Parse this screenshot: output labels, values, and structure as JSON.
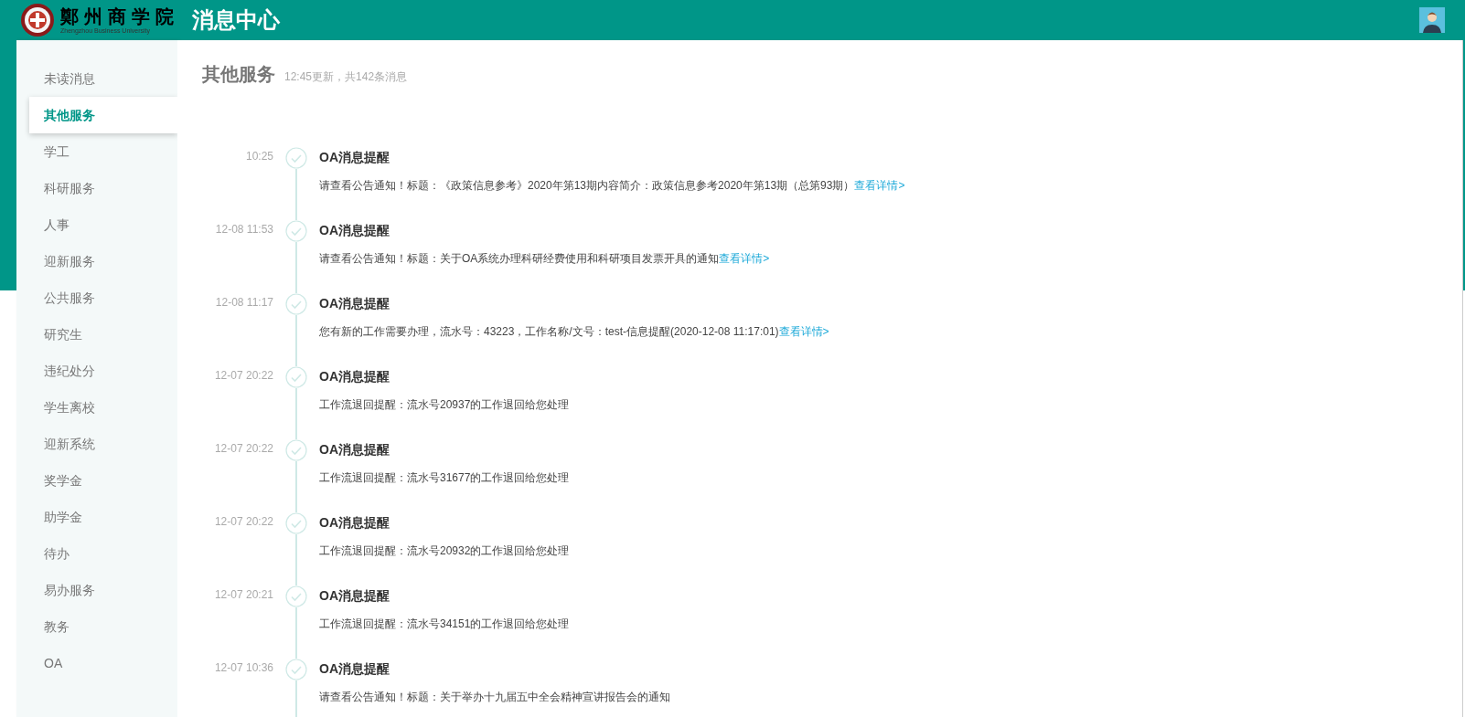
{
  "header": {
    "logo_text": "鄭州商学院",
    "logo_subtitle": "Zhengzhou Business University",
    "title": "消息中心"
  },
  "sidebar": {
    "items": [
      {
        "label": "未读消息",
        "selected": false
      },
      {
        "label": "其他服务",
        "selected": true
      },
      {
        "label": "学工",
        "selected": false
      },
      {
        "label": "科研服务",
        "selected": false
      },
      {
        "label": "人事",
        "selected": false
      },
      {
        "label": "迎新服务",
        "selected": false
      },
      {
        "label": "公共服务",
        "selected": false
      },
      {
        "label": "研究生",
        "selected": false
      },
      {
        "label": "违纪处分",
        "selected": false
      },
      {
        "label": "学生离校",
        "selected": false
      },
      {
        "label": "迎新系统",
        "selected": false
      },
      {
        "label": "奖学金",
        "selected": false
      },
      {
        "label": "助学金",
        "selected": false
      },
      {
        "label": "待办",
        "selected": false
      },
      {
        "label": "易办服务",
        "selected": false
      },
      {
        "label": "教务",
        "selected": false
      },
      {
        "label": "OA",
        "selected": false
      }
    ]
  },
  "content": {
    "title": "其他服务",
    "subtitle": "12:45更新，共142条消息",
    "messages": [
      {
        "time": "10:25",
        "title": "OA消息提醒",
        "text": "请查看公告通知！标题：《政策信息参考》2020年第13期内容简介：政策信息参考2020年第13期（总第93期）",
        "link": "查看详情>"
      },
      {
        "time": "12-08 11:53",
        "title": "OA消息提醒",
        "text": "请查看公告通知！标题：关于OA系统办理科研经费使用和科研项目发票开具的通知",
        "link": "查看详情>"
      },
      {
        "time": "12-08 11:17",
        "title": "OA消息提醒",
        "text": "您有新的工作需要办理，流水号：43223，工作名称/文号：test-信息提醒(2020-12-08 11:17:01)",
        "link": "查看详情>"
      },
      {
        "time": "12-07 20:22",
        "title": "OA消息提醒",
        "text": "工作流退回提醒：流水号20937的工作退回给您处理"
      },
      {
        "time": "12-07 20:22",
        "title": "OA消息提醒",
        "text": "工作流退回提醒：流水号31677的工作退回给您处理"
      },
      {
        "time": "12-07 20:22",
        "title": "OA消息提醒",
        "text": "工作流退回提醒：流水号20932的工作退回给您处理"
      },
      {
        "time": "12-07 20:21",
        "title": "OA消息提醒",
        "text": "工作流退回提醒：流水号34151的工作退回给您处理"
      },
      {
        "time": "12-07 10:36",
        "title": "OA消息提醒",
        "text": "请查看公告通知！标题：关于举办十九届五中全会精神宣讲报告会的通知"
      }
    ]
  }
}
